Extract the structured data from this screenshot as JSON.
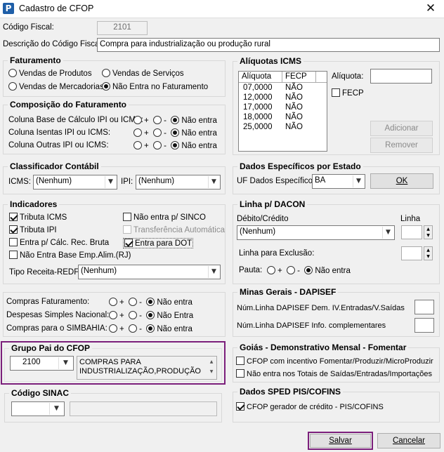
{
  "window": {
    "title": "Cadastro de CFOP",
    "app_icon": "P"
  },
  "header": {
    "codigo_label": "Código Fiscal:",
    "codigo_value": "2101",
    "descricao_label": "Descrição do Código Fiscal:",
    "descricao_value": "Compra para industrialização ou produção rural"
  },
  "faturamento": {
    "title": "Faturamento",
    "options": [
      {
        "label": "Vendas de Produtos",
        "selected": false
      },
      {
        "label": "Vendas de Serviços",
        "selected": false
      },
      {
        "label": "Vendas de Mercadorias",
        "selected": false
      },
      {
        "label": "Não Entra no Faturamento",
        "selected": true
      }
    ]
  },
  "composicao": {
    "title": "Composição do Faturamento",
    "rows": [
      {
        "label": "Coluna Base de Cálculo IPI ou ICMS:",
        "plus": "+",
        "minus": "-",
        "none": "Não entra"
      },
      {
        "label": "Coluna Isentas IPI ou ICMS:",
        "plus": "+",
        "minus": "-",
        "none": "Não entra"
      },
      {
        "label": "Coluna Outras IPI ou ICMS:",
        "plus": "+",
        "minus": "-",
        "none": "Não entra"
      }
    ]
  },
  "classificador": {
    "title": "Classificador Contábil",
    "icms_label": "ICMS:",
    "icms_value": "(Nenhum)",
    "ipi_label": "IPI:",
    "ipi_value": "(Nenhum)"
  },
  "indicadores": {
    "title": "Indicadores",
    "tributa_icms": "Tributa ICMS",
    "tributa_ipi": "Tributa IPI",
    "entra_calc": "Entra p/ Cálc. Rec. Bruta",
    "nao_entra_base": "Não Entra Base Emp.Alim.(RJ)",
    "nao_entra_sinco": "Não entra p/ SINCO",
    "transferencia": "Transferência Automática",
    "entra_dot": "Entra para DOT",
    "tipo_receita_label": "Tipo Receita-REDF:",
    "tipo_receita_value": "(Nenhum)"
  },
  "compras": {
    "rows": [
      {
        "label": "Compras Faturamento:",
        "plus": "+",
        "minus": "-",
        "none": "Não entra"
      },
      {
        "label": "Despesas Simples Nacional:",
        "plus": "+",
        "minus": "-",
        "none": "Não Entra"
      },
      {
        "label": "Compras para o SIMBAHIA:",
        "plus": "+",
        "minus": "-",
        "none": "Não entra"
      }
    ]
  },
  "grupo_pai": {
    "title": "Grupo Pai do CFOP",
    "code": "2100",
    "description": "COMPRAS PARA INDUSTRIALIZAÇÃO,PRODUÇÃO"
  },
  "codigo_sinac": {
    "title": "Código SINAC",
    "value": ""
  },
  "aliquotas": {
    "title": "Alíquotas ICMS",
    "columns": [
      "Alíquota",
      "FECP"
    ],
    "rows": [
      [
        "07,0000",
        "NÃO"
      ],
      [
        "12,0000",
        "NÃO"
      ],
      [
        "17,0000",
        "NÃO"
      ],
      [
        "18,0000",
        "NÃO"
      ],
      [
        "25,0000",
        "NÃO"
      ]
    ],
    "aliquota_label": "Alíquota:",
    "fecp_label": "FECP",
    "adicionar": "Adicionar",
    "remover": "Remover"
  },
  "dados_estado": {
    "title": "Dados Específicos por Estado",
    "uf_label": "UF Dados Específicos:",
    "uf_value": "BA",
    "ok": "OK"
  },
  "linha_dacon": {
    "title": "Linha p/ DACON",
    "debito_label": "Débito/Crédito",
    "debito_value": "(Nenhum)",
    "linha_label": "Linha",
    "exclusao_label": "Linha para Exclusão:",
    "pauta_label": "Pauta:",
    "plus": "+",
    "minus": "-",
    "none": "Não entra"
  },
  "minas": {
    "title": "Minas Gerais - DAPISEF",
    "row1": "Núm.Linha DAPISEF Dem. IV.Entradas/V.Saídas",
    "row2": "Núm.Linha DAPISEF Info. complementares"
  },
  "goias": {
    "title": "Goiás - Demonstrativo Mensal - Fomentar",
    "opt1": "CFOP com incentivo  Fomentar/Produzir/MicroProduzir",
    "opt2": "Não entra nos Totais de  Saídas/Entradas/Importações"
  },
  "sped": {
    "title": "Dados SPED PIS/COFINS",
    "opt1": "CFOP gerador de crédito - PIS/COFINS"
  },
  "footer": {
    "salvar": "Salvar",
    "cancelar": "Cancelar"
  },
  "colors": {
    "highlight": "#7b1f7b",
    "app_icon": "#1f5fa8"
  }
}
